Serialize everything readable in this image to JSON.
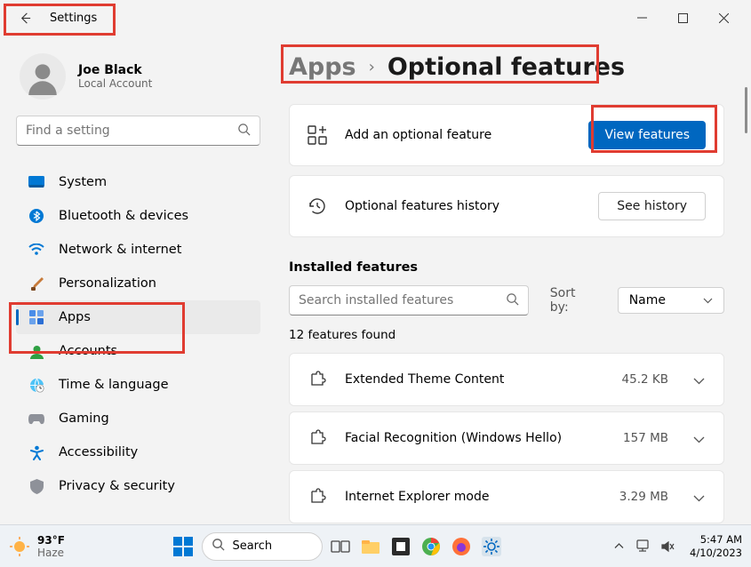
{
  "titlebar": {
    "title": "Settings"
  },
  "user": {
    "name": "Joe Black",
    "subtitle": "Local Account"
  },
  "search": {
    "placeholder": "Find a setting"
  },
  "nav": [
    {
      "id": "system",
      "label": "System"
    },
    {
      "id": "bluetooth",
      "label": "Bluetooth & devices"
    },
    {
      "id": "network",
      "label": "Network & internet"
    },
    {
      "id": "personalization",
      "label": "Personalization"
    },
    {
      "id": "apps",
      "label": "Apps",
      "selected": true
    },
    {
      "id": "accounts",
      "label": "Accounts"
    },
    {
      "id": "time",
      "label": "Time & language"
    },
    {
      "id": "gaming",
      "label": "Gaming"
    },
    {
      "id": "accessibility",
      "label": "Accessibility"
    },
    {
      "id": "privacy",
      "label": "Privacy & security"
    }
  ],
  "breadcrumb": {
    "parent": "Apps",
    "current": "Optional features"
  },
  "addCard": {
    "label": "Add an optional feature",
    "button": "View features"
  },
  "historyCard": {
    "label": "Optional features history",
    "button": "See history"
  },
  "installed": {
    "header": "Installed features",
    "searchPlaceholder": "Search installed features",
    "sortLabel": "Sort by:",
    "sortValue": "Name",
    "countText": "12 features found",
    "items": [
      {
        "name": "Extended Theme Content",
        "size": "45.2 KB"
      },
      {
        "name": "Facial Recognition (Windows Hello)",
        "size": "157 MB"
      },
      {
        "name": "Internet Explorer mode",
        "size": "3.29 MB"
      }
    ]
  },
  "taskbar": {
    "weather": {
      "temp": "93°F",
      "cond": "Haze"
    },
    "search": "Search",
    "time": "5:47 AM",
    "date": "4/10/2023"
  }
}
